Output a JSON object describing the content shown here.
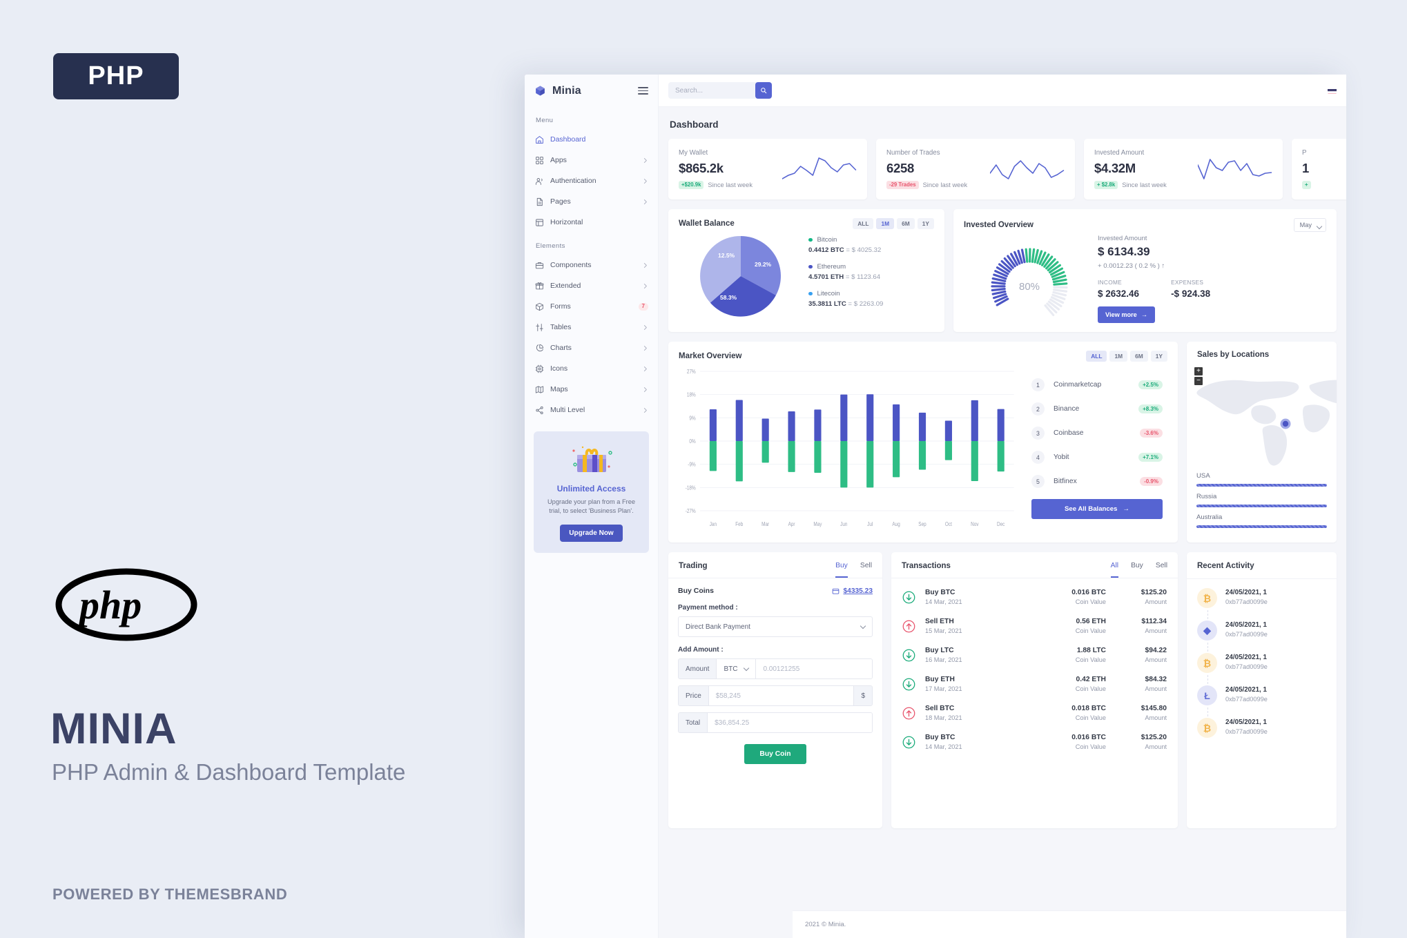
{
  "promo": {
    "badge": "PHP",
    "logo_text": "php",
    "title": "MINIA",
    "subtitle": "PHP Admin & Dashboard Template",
    "powered_by": "POWERED BY THEMESBRAND"
  },
  "sidebar": {
    "brand": "Minia",
    "logo_icon": "cube-icon",
    "menu_heading": "Menu",
    "elements_heading": "Elements",
    "menu_items": [
      {
        "label": "Dashboard",
        "icon": "home-icon",
        "active": true,
        "arrow": false
      },
      {
        "label": "Apps",
        "icon": "grid-icon",
        "active": false,
        "arrow": true
      },
      {
        "label": "Authentication",
        "icon": "users-icon",
        "active": false,
        "arrow": true
      },
      {
        "label": "Pages",
        "icon": "file-icon",
        "active": false,
        "arrow": true
      },
      {
        "label": "Horizontal",
        "icon": "layout-icon",
        "active": false,
        "arrow": false
      }
    ],
    "element_items": [
      {
        "label": "Components",
        "icon": "briefcase-icon",
        "active": false,
        "arrow": true,
        "badge": ""
      },
      {
        "label": "Extended",
        "icon": "gift-icon",
        "active": false,
        "arrow": true,
        "badge": ""
      },
      {
        "label": "Forms",
        "icon": "box-icon",
        "active": false,
        "arrow": false,
        "badge": "7"
      },
      {
        "label": "Tables",
        "icon": "sliders-icon",
        "active": false,
        "arrow": true,
        "badge": ""
      },
      {
        "label": "Charts",
        "icon": "pie-chart-icon",
        "active": false,
        "arrow": true,
        "badge": ""
      },
      {
        "label": "Icons",
        "icon": "cpu-icon",
        "active": false,
        "arrow": true,
        "badge": ""
      },
      {
        "label": "Maps",
        "icon": "map-icon",
        "active": false,
        "arrow": true,
        "badge": ""
      },
      {
        "label": "Multi Level",
        "icon": "share-icon",
        "active": false,
        "arrow": true,
        "badge": ""
      }
    ],
    "upgrade": {
      "image_icon": "gift-box-illustration",
      "title": "Unlimited Access",
      "text": "Upgrade your plan from a Free trial, to select 'Business Plan'.",
      "button": "Upgrade Now"
    }
  },
  "topbar": {
    "search_placeholder": "Search...",
    "search_icon": "search-icon",
    "flag_icon": "flag-icon"
  },
  "page": {
    "title": "Dashboard"
  },
  "stats": [
    {
      "title": "My Wallet",
      "value": "$865.2k",
      "pill": "+$20.9k",
      "pill_dir": "up",
      "since": "Since last week",
      "spark": "wallet-sparkline"
    },
    {
      "title": "Number of Trades",
      "value": "6258",
      "pill": "-29 Trades",
      "pill_dir": "down",
      "since": "Since last week",
      "spark": "trades-sparkline"
    },
    {
      "title": "Invested Amount",
      "value": "$4.32M",
      "pill": "+ $2.8k",
      "pill_dir": "up",
      "since": "Since last week",
      "spark": "invested-sparkline"
    },
    {
      "title": "P",
      "value": "1",
      "pill": "+",
      "pill_dir": "up",
      "since": "",
      "spark": "profit-sparkline"
    }
  ],
  "wallet_balance": {
    "title": "Wallet Balance",
    "ranges": [
      {
        "label": "ALL",
        "active": false
      },
      {
        "label": "1M",
        "active": true
      },
      {
        "label": "6M",
        "active": false
      },
      {
        "label": "1Y",
        "active": false
      }
    ],
    "coins": [
      {
        "name": "Bitcoin",
        "value": "0.4412 BTC",
        "equals": "= $ 4025.32",
        "color": "#12b886",
        "percent": 29.2
      },
      {
        "name": "Ethereum",
        "value": "4.5701 ETH",
        "equals": "= $ 1123.64",
        "color": "#4b55c4",
        "percent": 58.3
      },
      {
        "name": "Litecoin",
        "value": "35.3811 LTC",
        "equals": "= $ 2263.09",
        "color": "#38a0f0",
        "percent": 12.5
      }
    ],
    "pie_labels": [
      "12.5%",
      "29.2%",
      "58.3%"
    ]
  },
  "invested_overview": {
    "title": "Invested Overview",
    "month": "May",
    "gauge_percent": "80%",
    "amount_label": "Invested Amount",
    "amount": "$ 6134.39",
    "change": "+ 0.0012.23 ( 0.2 % )  ↑",
    "income_label": "INCOME",
    "income": "$ 2632.46",
    "expenses_label": "EXPENSES",
    "expenses": "-$ 924.38",
    "view_more": "View more"
  },
  "market_overview": {
    "title": "Market Overview",
    "ranges": [
      {
        "label": "ALL",
        "active": true
      },
      {
        "label": "1M",
        "active": false
      },
      {
        "label": "6M",
        "active": false
      },
      {
        "label": "1Y",
        "active": false
      }
    ],
    "exchanges": [
      {
        "rank": "1",
        "name": "Coinmarketcap",
        "change": "+2.5%",
        "dir": "up"
      },
      {
        "rank": "2",
        "name": "Binance",
        "change": "+8.3%",
        "dir": "up"
      },
      {
        "rank": "3",
        "name": "Coinbase",
        "change": "-3.6%",
        "dir": "down"
      },
      {
        "rank": "4",
        "name": "Yobit",
        "change": "+7.1%",
        "dir": "up"
      },
      {
        "rank": "5",
        "name": "Bitfinex",
        "change": "-0.9%",
        "dir": "down"
      }
    ],
    "see_all": "See All Balances"
  },
  "chart_data": [
    {
      "type": "bar",
      "title": "Market Overview",
      "xlabel": "",
      "ylabel": "",
      "categories": [
        "Jan",
        "Feb",
        "Mar",
        "Apr",
        "May",
        "Jun",
        "Jul",
        "Aug",
        "Sep",
        "Oct",
        "Nov",
        "Dec"
      ],
      "ytick_labels": [
        "27%",
        "18%",
        "9%",
        "0%",
        "-9%",
        "-18%",
        "-27%"
      ],
      "ylim": [
        -27,
        27
      ],
      "grid": true,
      "legend": "none",
      "series": [
        {
          "name": "Positive",
          "color": "#4b55c4",
          "values": [
            12.3,
            15.9,
            8.7,
            11.5,
            12.2,
            18.0,
            18.1,
            14.2,
            11.0,
            7.9,
            15.8,
            12.4
          ]
        },
        {
          "name": "Negative",
          "color": "#2ebd85",
          "values": [
            -11.6,
            -15.6,
            -8.4,
            -12.0,
            -12.3,
            -18.0,
            -18.0,
            -14.0,
            -11.1,
            -7.4,
            -15.5,
            -11.8
          ]
        }
      ]
    },
    {
      "type": "pie",
      "title": "Wallet Balance",
      "labels": [
        "Bitcoin",
        "Ethereum",
        "Litecoin"
      ],
      "values": [
        29.2,
        58.3,
        12.5
      ],
      "colors": [
        "#7c86dd",
        "#4b55c4",
        "#aeb5ea"
      ],
      "data_labels": [
        "29.2%",
        "58.3%",
        "12.5%"
      ]
    },
    {
      "type": "gauge",
      "title": "Invested Overview",
      "value": 80,
      "label": "80%",
      "range": [
        0,
        100
      ],
      "colors": [
        "#4b55c4",
        "#2ebd85"
      ]
    },
    {
      "type": "bar",
      "title": "Sales by Locations",
      "categories": [
        "USA",
        "Russia",
        "Australia"
      ],
      "values": [
        100,
        100,
        100
      ],
      "orientation": "horizontal",
      "color": "#5664d2"
    }
  ],
  "sales_locations": {
    "title": "Sales by Locations",
    "zoom_in": "+",
    "zoom_out": "−",
    "locations": [
      {
        "name": "USA",
        "percent": 100
      },
      {
        "name": "Russia",
        "percent": 100
      },
      {
        "name": "Australia",
        "percent": 100
      }
    ]
  },
  "trading": {
    "title": "Trading",
    "tabs": [
      {
        "label": "Buy",
        "active": true
      },
      {
        "label": "Sell",
        "active": false
      }
    ],
    "buy_coins_label": "Buy Coins",
    "wallet_icon": "wallet-icon",
    "wallet_balance": "$4335.23",
    "payment_method_label": "Payment method :",
    "payment_method_value": "Direct Bank Payment",
    "add_amount_label": "Add Amount :",
    "amount_addon": "Amount",
    "currency": "BTC",
    "amount_placeholder": "0.00121255",
    "price_addon": "Price",
    "price_placeholder": "$58,245",
    "price_suffix": "$",
    "total_addon": "Total",
    "total_placeholder": "$36,854.25",
    "buy_button": "Buy Coin"
  },
  "transactions": {
    "title": "Transactions",
    "tabs": [
      {
        "label": "All",
        "active": true
      },
      {
        "label": "Buy",
        "active": false
      },
      {
        "label": "Sell",
        "active": false
      }
    ],
    "coin_value_label": "Coin Value",
    "amount_label": "Amount",
    "items": [
      {
        "name": "Buy BTC",
        "date": "14 Mar, 2021",
        "coin": "0.016 BTC",
        "amount": "$125.20",
        "dir": "buy"
      },
      {
        "name": "Sell ETH",
        "date": "15 Mar, 2021",
        "coin": "0.56 ETH",
        "amount": "$112.34",
        "dir": "sell"
      },
      {
        "name": "Buy LTC",
        "date": "16 Mar, 2021",
        "coin": "1.88 LTC",
        "amount": "$94.22",
        "dir": "buy"
      },
      {
        "name": "Buy ETH",
        "date": "17 Mar, 2021",
        "coin": "0.42 ETH",
        "amount": "$84.32",
        "dir": "buy"
      },
      {
        "name": "Sell BTC",
        "date": "18 Mar, 2021",
        "coin": "0.018 BTC",
        "amount": "$145.80",
        "dir": "sell"
      },
      {
        "name": "Buy BTC",
        "date": "14 Mar, 2021",
        "coin": "0.016 BTC",
        "amount": "$125.20",
        "dir": "buy"
      }
    ]
  },
  "recent_activity": {
    "title": "Recent Activity",
    "items": [
      {
        "date": "24/05/2021, 1",
        "hash": "0xb77ad0099e",
        "coin": "btc",
        "symbol": "₿"
      },
      {
        "date": "24/05/2021, 1",
        "hash": "0xb77ad0099e",
        "coin": "eth",
        "symbol": "◆"
      },
      {
        "date": "24/05/2021, 1",
        "hash": "0xb77ad0099e",
        "coin": "btc",
        "symbol": "₿"
      },
      {
        "date": "24/05/2021, 1",
        "hash": "0xb77ad0099e",
        "coin": "ltc",
        "symbol": "Ł"
      },
      {
        "date": "24/05/2021, 1",
        "hash": "0xb77ad0099e",
        "coin": "btc",
        "symbol": "₿"
      }
    ]
  },
  "footer": {
    "copyright": "2021 © Minia."
  }
}
